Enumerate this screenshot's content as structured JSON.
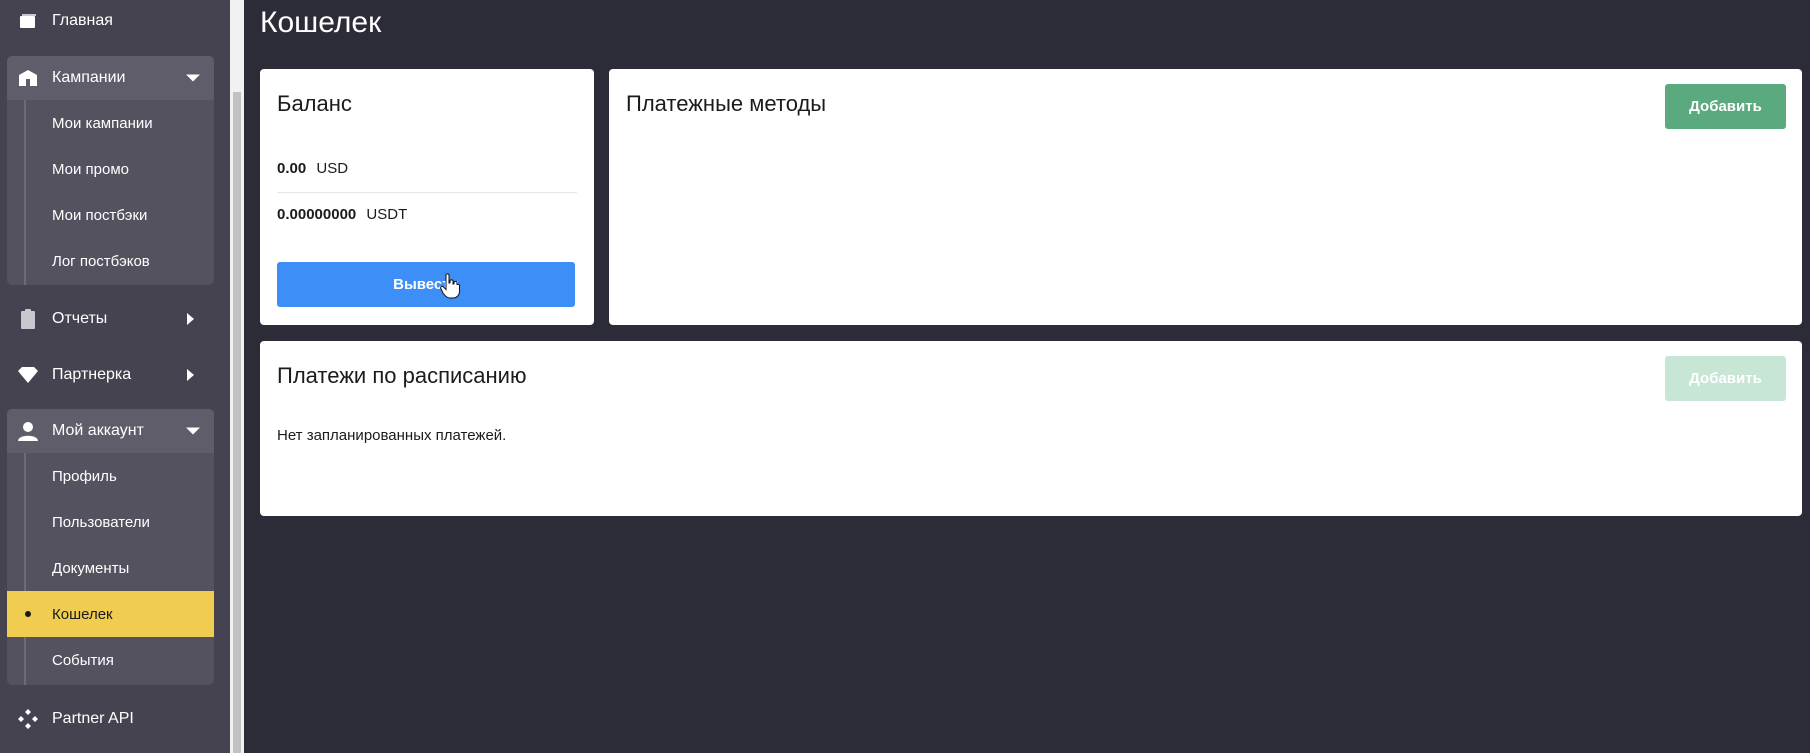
{
  "sidebar": {
    "home": {
      "label": "Главная",
      "icon": "home-icon"
    },
    "campaigns": {
      "label": "Кампании",
      "icon": "building-icon",
      "items": [
        {
          "label": "Мои кампании"
        },
        {
          "label": "Мои промо"
        },
        {
          "label": "Мои постбэки"
        },
        {
          "label": "Лог постбэков"
        }
      ]
    },
    "reports": {
      "label": "Отчеты",
      "icon": "clipboard-icon"
    },
    "partner": {
      "label": "Партнерка",
      "icon": "diamond-icon"
    },
    "account": {
      "label": "Мой аккаунт",
      "icon": "user-icon",
      "items": [
        {
          "label": "Профиль"
        },
        {
          "label": "Пользователи"
        },
        {
          "label": "Документы"
        },
        {
          "label": "Кошелек",
          "active": true
        },
        {
          "label": "События"
        }
      ]
    },
    "api": {
      "label": "Partner API",
      "icon": "api-icon"
    }
  },
  "page": {
    "title": "Кошелек"
  },
  "balance": {
    "title": "Баланс",
    "rows": [
      {
        "amount": "0.00",
        "currency": "USD"
      },
      {
        "amount": "0.00000000",
        "currency": "USDT"
      }
    ],
    "withdraw_label": "Вывести"
  },
  "payment_methods": {
    "title": "Платежные методы",
    "add_label": "Добавить"
  },
  "scheduled": {
    "title": "Платежи по расписанию",
    "add_label": "Добавить",
    "empty_text": "Нет запланированных платежей."
  },
  "colors": {
    "background": "#2c2b38",
    "sidebar": "#45434f",
    "active_item": "#f0cc50",
    "primary_button": "#3e8ef7",
    "success_button": "#5aa97f"
  }
}
